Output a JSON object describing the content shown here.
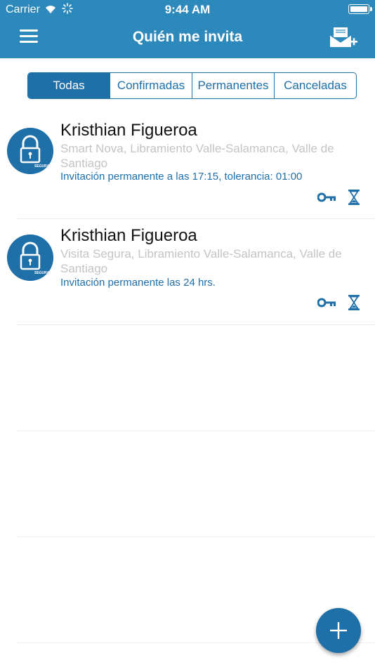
{
  "status_bar": {
    "carrier": "Carrier",
    "time": "9:44 AM"
  },
  "header": {
    "title": "Quién me invita"
  },
  "tabs": [
    {
      "label": "Todas",
      "active": true
    },
    {
      "label": "Confirmadas",
      "active": false
    },
    {
      "label": "Permanentes",
      "active": false
    },
    {
      "label": "Canceladas",
      "active": false
    }
  ],
  "invitations": [
    {
      "name": "Kristhian Figueroa",
      "address": "Smart Nova, Libramiento Valle-Salamanca, Valle de Santiago",
      "detail": "Invitación permanente a las 17:15, tolerancia: 01:00",
      "avatar_text": "SEGURA"
    },
    {
      "name": "Kristhian Figueroa",
      "address": "Visita Segura, Libramiento Valle-Salamanca, Valle de Santiago",
      "detail": "Invitación permanente las 24 hrs.",
      "avatar_text": "SEGURA"
    }
  ],
  "colors": {
    "navbar": "#2d88bb",
    "accent": "#1f6fa8",
    "address": "#c4c4c4"
  },
  "icons": [
    "menu-icon",
    "invite-mail-icon",
    "key-icon",
    "hourglass-icon",
    "plus-icon",
    "wifi-icon",
    "battery-icon"
  ]
}
